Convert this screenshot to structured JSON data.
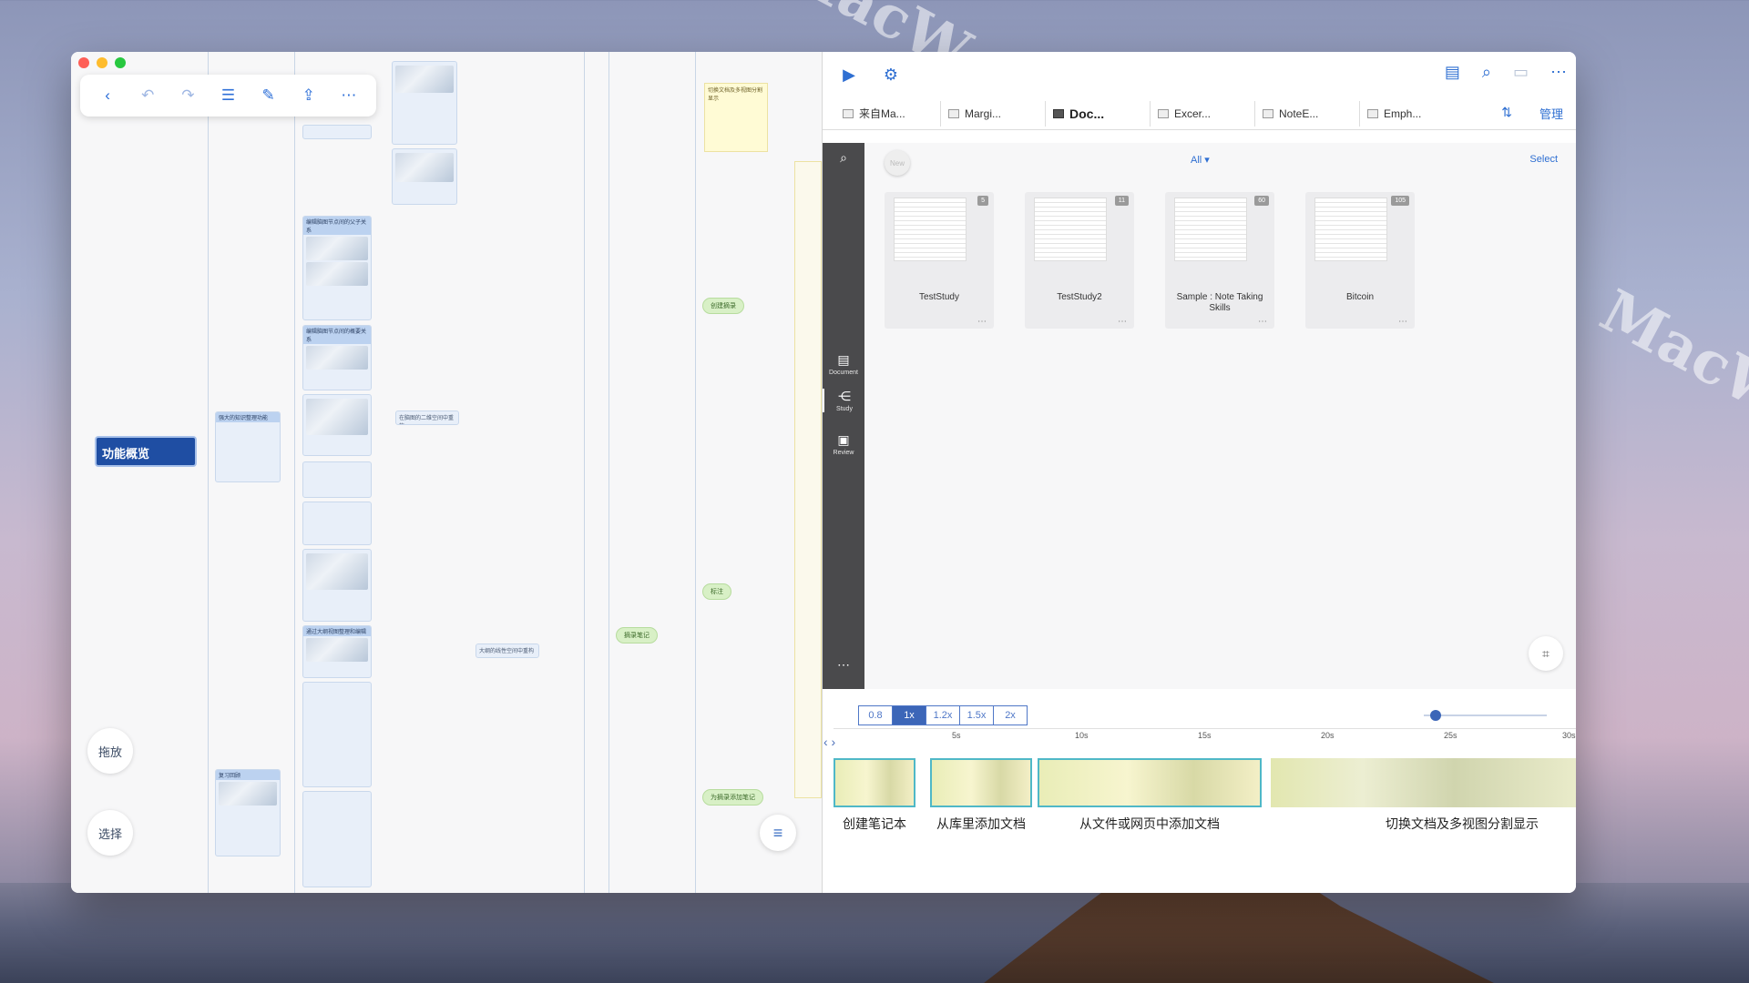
{
  "watermark": "MacW.com",
  "toolbar": {
    "back_icon": "‹",
    "undo_icon": "↶",
    "redo_icon": "↷",
    "list_icon": "☰",
    "edit_icon": "✎",
    "share_icon": "⇪",
    "more_icon": "⋯"
  },
  "mindmap": {
    "root": "功能概览",
    "side_buttons": {
      "drag": "拖放",
      "select": "选择"
    },
    "notes": {
      "n1": "编辑脑图节点间的父子关系",
      "n2": "编辑脑图节点间的概要关系",
      "n3": "复习回顾",
      "n4": "强大的知识整理功能",
      "n5": "摘录笔记",
      "n6": "创建摘录",
      "n7": "标注",
      "n8": "为摘录添加笔记",
      "n9": "切换文档及多视图分割显示",
      "n10": "在脑图的二维空间中重构",
      "n11": "大纲的线性空间中重构",
      "n12": "通过大纲视图整理和编辑"
    }
  },
  "docpanel": {
    "tabs": [
      {
        "label": "来自Ma..."
      },
      {
        "label": "Margi..."
      },
      {
        "label": "Doc..."
      },
      {
        "label": "Excer..."
      },
      {
        "label": "NoteE..."
      },
      {
        "label": "Emph..."
      }
    ],
    "manage": "管理",
    "sidebar": {
      "document": "Document",
      "study": "Study",
      "review": "Review"
    },
    "library": {
      "new": "New",
      "filter": "All ▾",
      "select": "Select",
      "cards": [
        {
          "title": "TestStudy",
          "count": "5"
        },
        {
          "title": "TestStudy2",
          "count": "11"
        },
        {
          "title": "Sample : Note Taking Skills",
          "count": "60"
        },
        {
          "title": "Bitcoin",
          "count": "105"
        }
      ]
    }
  },
  "timeline": {
    "speeds": [
      "0.8",
      "1x",
      "1.2x",
      "1.5x",
      "2x"
    ],
    "active_speed": "1x",
    "ticks": [
      "5s",
      "10s",
      "15s",
      "20s",
      "25s",
      "30s"
    ],
    "clips": [
      "创建笔记本",
      "从库里添加文档",
      "从文件或网页中添加文档",
      "切换文档及多视图分割显示"
    ],
    "slider_value": 0.05
  }
}
